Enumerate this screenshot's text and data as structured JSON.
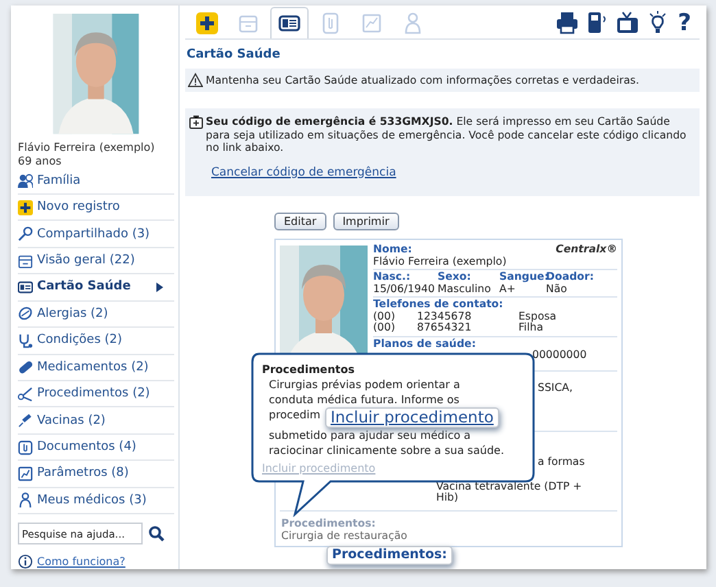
{
  "toolbar": {
    "tabs": [
      {
        "selected": false,
        "disabled": false
      },
      {
        "selected": false,
        "disabled": true
      },
      {
        "selected": true,
        "disabled": false
      },
      {
        "selected": false,
        "disabled": true
      },
      {
        "selected": false,
        "disabled": true
      },
      {
        "selected": false,
        "disabled": true
      }
    ],
    "help": "?"
  },
  "profile": {
    "name": "Flávio Ferreira (exemplo)",
    "age": "69 anos"
  },
  "sidebar": {
    "items": [
      {
        "label": "Família",
        "selected": false
      },
      {
        "label": "Novo registro",
        "selected": false
      },
      {
        "label": "Compartilhado (3)",
        "selected": false
      },
      {
        "label": "Visão geral (22)",
        "selected": false
      },
      {
        "label": "Cartão Saúde",
        "selected": true
      },
      {
        "label": "Alergias (2)",
        "selected": false
      },
      {
        "label": "Condições (2)",
        "selected": false
      },
      {
        "label": "Medicamentos (2)",
        "selected": false
      },
      {
        "label": "Procedimentos (2)",
        "selected": false
      },
      {
        "label": "Vacinas (2)",
        "selected": false
      },
      {
        "label": "Documentos (4)",
        "selected": false
      },
      {
        "label": "Parâmetros (8)",
        "selected": false
      },
      {
        "label": "Meus médicos (3)",
        "selected": false
      }
    ],
    "search": {
      "placeholder": "Pesquise na ajuda..."
    },
    "help_link": "Como funciona?"
  },
  "page": {
    "title": "Cartão Saúde",
    "notice": "Mantenha seu Cartão Saúde atualizado com informações corretas e verdadeiras.",
    "emergency": "**Seu código de emergência é 533GMXJS0.** Ele será impresso em seu Cartão Saúde para seja utilizado em situações de emergência. Você pode cancelar este código clicando no link abaixo.",
    "cancel_link": "Cancelar código de emergência",
    "buttons": [
      "Editar",
      "Imprimir"
    ]
  },
  "card": {
    "brand": "Centralx®",
    "name_label": "Nome:",
    "name": "Flávio Ferreira (exemplo)",
    "columns": [
      {
        "label": "Nasc.:",
        "value": "15/06/1940"
      },
      {
        "label": "Sexo:",
        "value": "Masculino"
      },
      {
        "label": "Sangue:",
        "value": "A+"
      },
      {
        "label": "Doador:",
        "value": "Não"
      }
    ],
    "phones_label": "Telefones de contato:",
    "phones": [
      {
        "code": "(00)",
        "number": "12345678",
        "contact": "Esposa"
      },
      {
        "code": "(00)",
        "number": "87654321",
        "contact": "Filha"
      }
    ],
    "plans_label": "Planos de saúde:",
    "plan_number": "00000000",
    "allergy_fragment": "SSICA,",
    "vaccine_lines": [
      "a formas",
      "Vacina tetravalente (DTP +",
      "Hib)"
    ],
    "procedures_label": "Procedimentos:",
    "procedures_line": "Cirurgia de restauração"
  },
  "tooltip": {
    "title": "Procedimentos",
    "lines": [
      "Cirurgias prévias podem orientar a",
      "conduta médica futura. Informe os",
      "procedim",
      "submetido para ajudar seu médico a",
      "raciocinar clinicamente sobre a sua saúde."
    ],
    "link": "Incluir procedimento"
  },
  "callouts": [
    {
      "kind": "link",
      "text": "Incluir procedimento"
    },
    {
      "kind": "label",
      "text": "Procedimentos:"
    }
  ]
}
